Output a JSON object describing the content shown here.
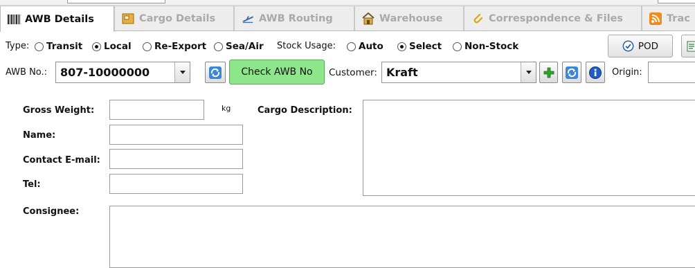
{
  "tabs": [
    {
      "label": "AWB Details",
      "icon": "barcode-icon",
      "active": true
    },
    {
      "label": "Cargo Details",
      "icon": "cargo-box-icon",
      "active": false
    },
    {
      "label": "AWB Routing",
      "icon": "airplane-icon",
      "active": false
    },
    {
      "label": "Warehouse",
      "icon": "warehouse-icon",
      "active": false
    },
    {
      "label": "Correspondence & Files",
      "icon": "paperclip-icon",
      "active": false
    },
    {
      "label": "Trac",
      "icon": "rss-icon",
      "active": false
    }
  ],
  "type_row": {
    "type_label": "Type:",
    "type_options": [
      {
        "label": "Transit",
        "selected": false
      },
      {
        "label": "Local",
        "selected": true
      },
      {
        "label": "Re-Export",
        "selected": false
      },
      {
        "label": "Sea/Air",
        "selected": false
      }
    ],
    "stock_label": "Stock Usage:",
    "stock_options": [
      {
        "label": "Auto",
        "selected": false
      },
      {
        "label": "Select",
        "selected": true
      },
      {
        "label": "Non-Stock",
        "selected": false
      }
    ],
    "pod_label": "POD"
  },
  "awb_row": {
    "awb_label": "AWB No.:",
    "awb_value": "807-10000000",
    "check_label": "Check AWB No",
    "customer_label": "Customer:",
    "customer_value": "Kraft",
    "origin_label": "Origin:"
  },
  "form": {
    "gross_weight_label": "Gross Weight:",
    "gross_weight_value": "",
    "unit": "kg",
    "name_label": "Name:",
    "name_value": "",
    "email_label": "Contact E-mail:",
    "email_value": "",
    "tel_label": "Tel:",
    "tel_value": "",
    "cargo_desc_label": "Cargo Description:",
    "cargo_desc_value": "",
    "consignee_label": "Consignee:",
    "consignee_value": ""
  },
  "colors": {
    "check_button": "#8ee68a",
    "active_tab": "#ffffff",
    "inactive_tab_text": "#a9a9a9"
  }
}
